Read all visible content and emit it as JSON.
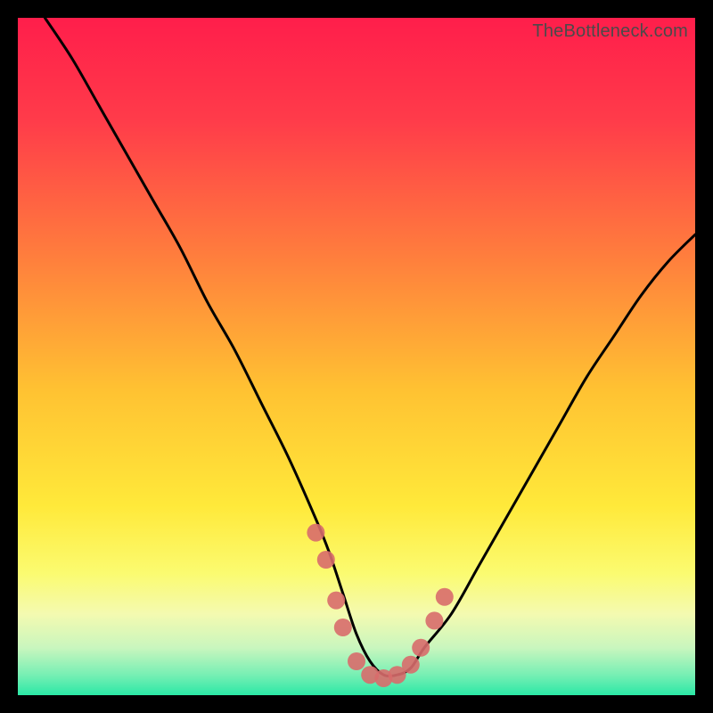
{
  "watermark": "TheBottleneck.com",
  "colors": {
    "background": "#000000",
    "curve_stroke": "#000000",
    "marker_fill": "#D86B6B",
    "gradient_stops": [
      {
        "offset": 0.0,
        "color": "#FF1E4B"
      },
      {
        "offset": 0.15,
        "color": "#FF3B4A"
      },
      {
        "offset": 0.35,
        "color": "#FF7D3D"
      },
      {
        "offset": 0.55,
        "color": "#FFC232"
      },
      {
        "offset": 0.72,
        "color": "#FFE93A"
      },
      {
        "offset": 0.82,
        "color": "#FBFB70"
      },
      {
        "offset": 0.88,
        "color": "#F4FAB0"
      },
      {
        "offset": 0.93,
        "color": "#C9F6BE"
      },
      {
        "offset": 0.97,
        "color": "#77EFB4"
      },
      {
        "offset": 1.0,
        "color": "#2BE8A6"
      }
    ]
  },
  "chart_data": {
    "type": "line",
    "title": "",
    "xlabel": "",
    "ylabel": "",
    "xlim": [
      0,
      100
    ],
    "ylim": [
      0,
      100
    ],
    "series": [
      {
        "name": "bottleneck-curve",
        "x": [
          4,
          8,
          12,
          16,
          20,
          24,
          28,
          32,
          36,
          40,
          44,
          46,
          48,
          50,
          52,
          54,
          56,
          58,
          60,
          64,
          68,
          72,
          76,
          80,
          84,
          88,
          92,
          96,
          100
        ],
        "y": [
          100,
          94,
          87,
          80,
          73,
          66,
          58,
          51,
          43,
          35,
          26,
          21,
          15,
          9,
          5,
          3,
          3,
          4,
          7,
          12,
          19,
          26,
          33,
          40,
          47,
          53,
          59,
          64,
          68
        ]
      }
    ],
    "markers": [
      {
        "x": 44.0,
        "y": 24.0
      },
      {
        "x": 45.5,
        "y": 20.0
      },
      {
        "x": 47.0,
        "y": 14.0
      },
      {
        "x": 48.0,
        "y": 10.0
      },
      {
        "x": 50.0,
        "y": 5.0
      },
      {
        "x": 52.0,
        "y": 3.0
      },
      {
        "x": 54.0,
        "y": 2.5
      },
      {
        "x": 56.0,
        "y": 3.0
      },
      {
        "x": 58.0,
        "y": 4.5
      },
      {
        "x": 59.5,
        "y": 7.0
      },
      {
        "x": 61.5,
        "y": 11.0
      },
      {
        "x": 63.0,
        "y": 14.5
      }
    ]
  }
}
